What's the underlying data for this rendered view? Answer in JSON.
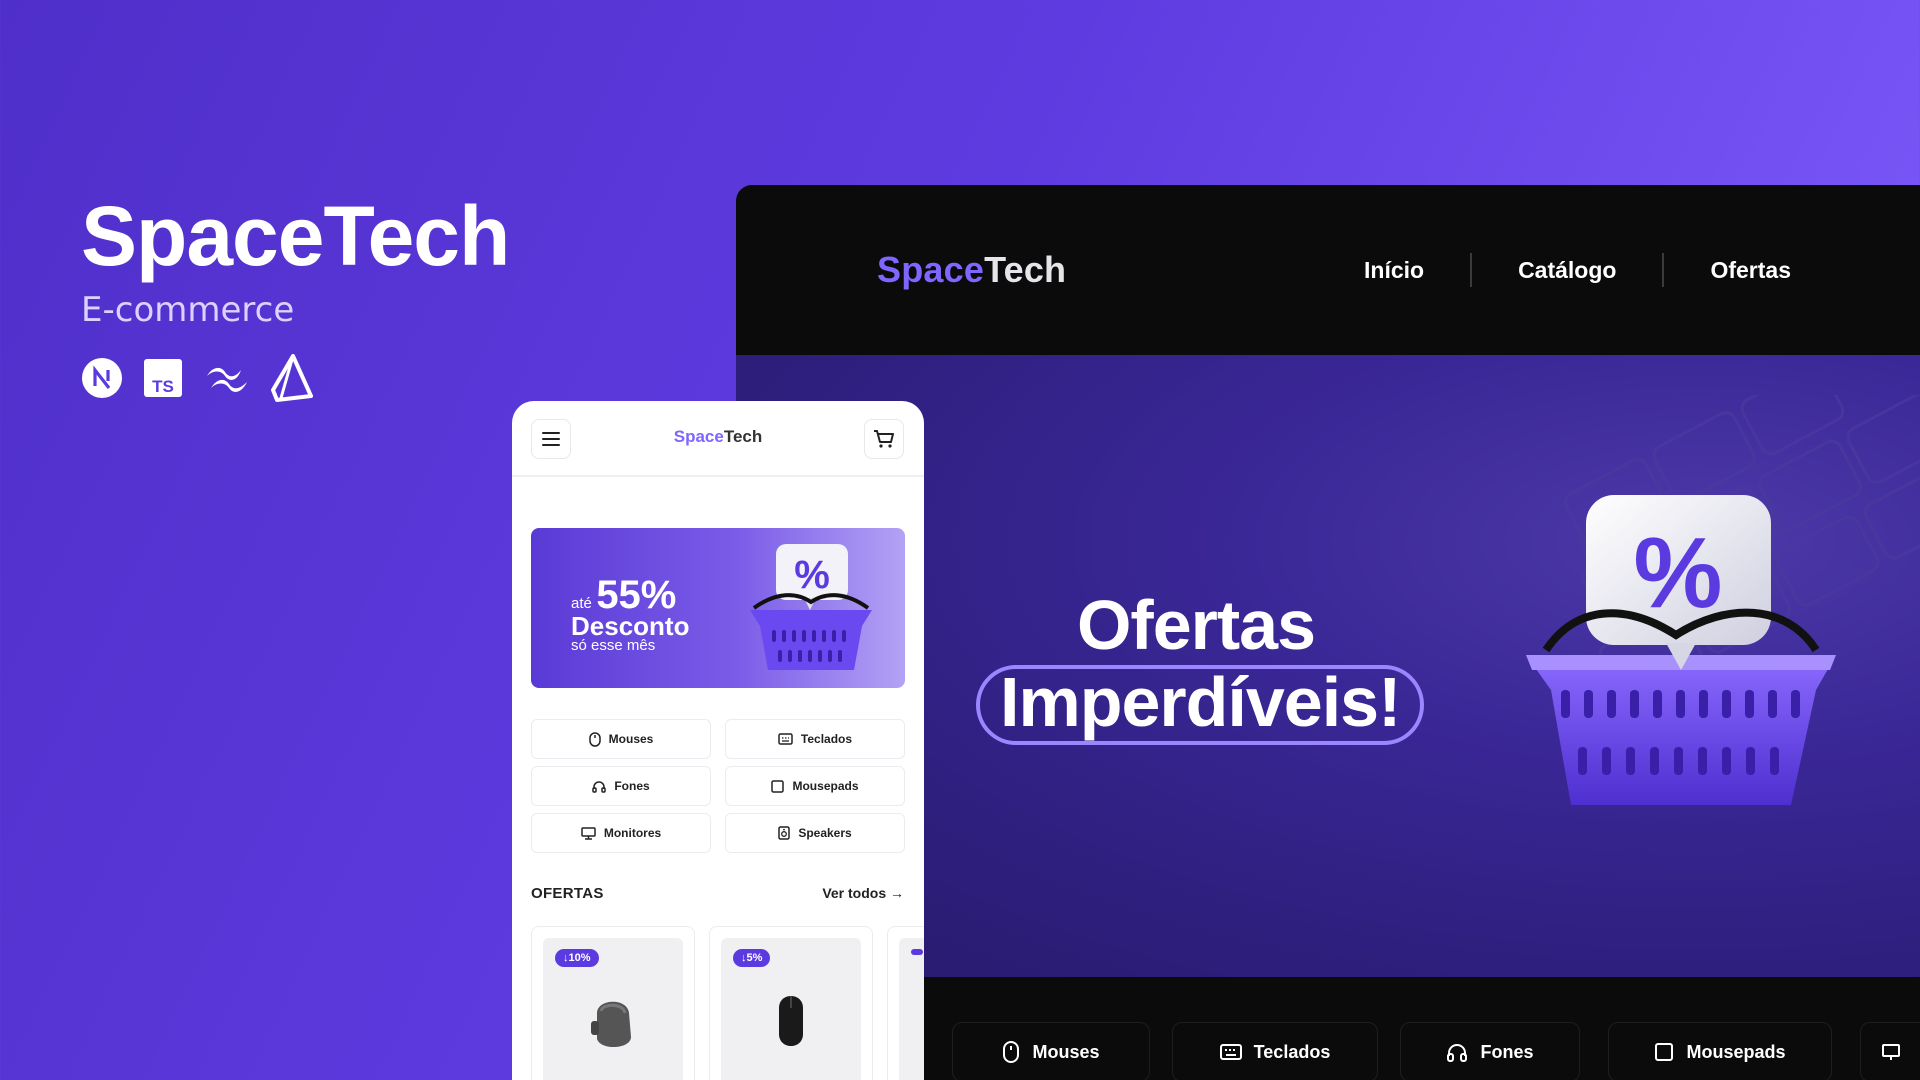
{
  "intro": {
    "title": "SpaceTech",
    "subtitle": "E-commerce",
    "tech_icons": [
      "nextjs-icon",
      "typescript-icon",
      "tailwind-icon",
      "prisma-icon"
    ],
    "ts_label": "TS"
  },
  "desktop": {
    "logo": {
      "part1": "Space",
      "part2": "Tech"
    },
    "nav": [
      "Início",
      "Catálogo",
      "Ofertas"
    ],
    "hero": {
      "line1": "Ofertas",
      "line2": "Imperdíveis!"
    },
    "categories": [
      "Mouses",
      "Teclados",
      "Fones",
      "Mousepads"
    ]
  },
  "mobile": {
    "logo": {
      "part1": "Space",
      "part2": "Tech"
    },
    "banner": {
      "ate": "até",
      "percent": "55%",
      "desconto": "Desconto",
      "mes": "só esse mês"
    },
    "categories": [
      "Mouses",
      "Teclados",
      "Fones",
      "Mousepads",
      "Monitores",
      "Speakers"
    ],
    "offers_title": "OFERTAS",
    "see_all": "Ver todos",
    "products": [
      {
        "badge": "10%"
      },
      {
        "badge": "5%"
      }
    ]
  },
  "colors": {
    "accent": "#7f66ff",
    "brand": "#5b3be0",
    "dark": "#0b0b0c"
  }
}
